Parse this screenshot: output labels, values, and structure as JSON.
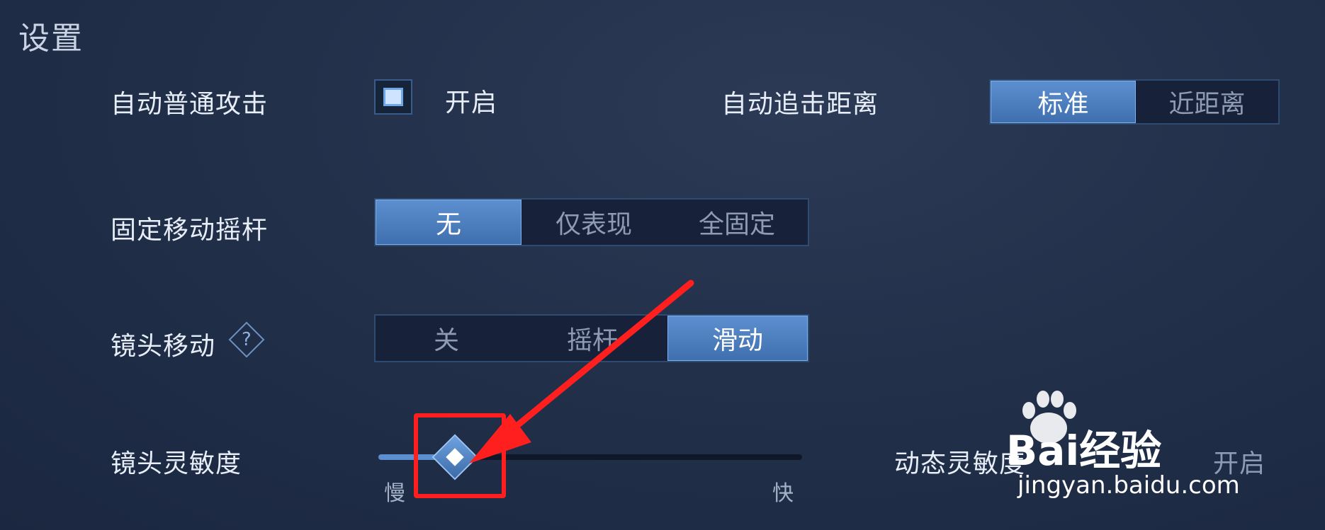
{
  "title": "设置",
  "auto_attack": {
    "label": "自动普通攻击",
    "checkbox_label": "开启",
    "checked": true
  },
  "auto_chase": {
    "label": "自动追击距离",
    "options": [
      "标准",
      "近距离"
    ],
    "selected": "标准"
  },
  "fixed_joystick": {
    "label": "固定移动摇杆",
    "options": [
      "无",
      "仅表现",
      "全固定"
    ],
    "selected": "无"
  },
  "camera_move": {
    "label": "镜头移动",
    "help": "?",
    "options": [
      "关",
      "摇杆",
      "滑动"
    ],
    "selected": "滑动"
  },
  "camera_sensitivity": {
    "label": "镜头灵敏度",
    "min_label": "慢",
    "max_label": "快",
    "value_fraction": 0.18
  },
  "dynamic_sensitivity": {
    "label": "动态灵敏度",
    "checkbox_label": "开启"
  },
  "colors": {
    "accent": "#5d8fd0",
    "annotation": "#ff1f1f"
  },
  "watermark": {
    "text": "Bai经验",
    "url": "jingyan.baidu.com"
  }
}
